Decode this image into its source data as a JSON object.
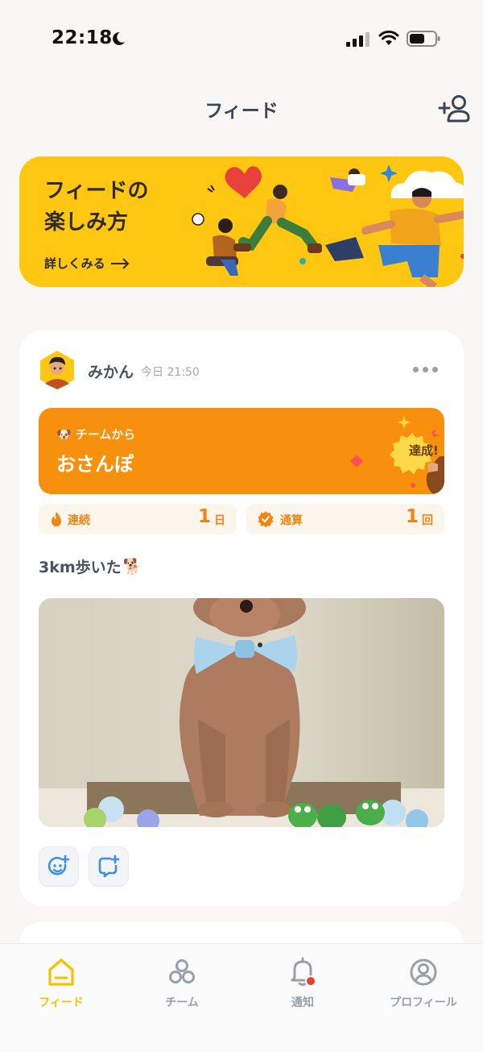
{
  "status_bar": {
    "time": "22:18"
  },
  "header": {
    "title": "フィード"
  },
  "banner": {
    "title_line1": "フィードの",
    "title_line2": "楽しみ方",
    "more_label": "詳しくみる"
  },
  "post": {
    "user_name": "みかん",
    "time": "今日 21:50",
    "goal": {
      "from_emoji": "🐶",
      "from_label": "チームから",
      "title": "おさんぽ",
      "badge": "達成!"
    },
    "stats": [
      {
        "label": "連続",
        "value": "1",
        "unit": "日"
      },
      {
        "label": "通算",
        "value": "1",
        "unit": "回"
      }
    ],
    "text": "3km歩いた",
    "text_emoji": "🐕"
  },
  "tabs": [
    {
      "label": "フィード",
      "icon": "home-icon",
      "active": true
    },
    {
      "label": "チーム",
      "icon": "team-icon",
      "active": false
    },
    {
      "label": "通知",
      "icon": "bell-icon",
      "active": false
    },
    {
      "label": "プロフィール",
      "icon": "profile-icon",
      "active": false
    }
  ],
  "colors": {
    "accent": "#ffc612",
    "goal_orange": "#f7900d",
    "stat_orange": "#f0850f",
    "notification_dot": "#e8402d"
  }
}
